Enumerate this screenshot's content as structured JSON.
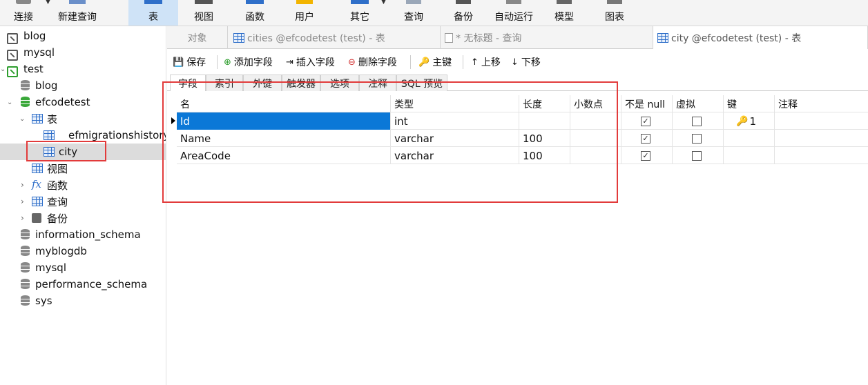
{
  "toolbar": {
    "items": [
      {
        "label": "连接",
        "icon": "connect-icon"
      },
      {
        "label": "新建查询",
        "icon": "new-query-icon"
      },
      {
        "label": "表",
        "icon": "table-icon"
      },
      {
        "label": "视图",
        "icon": "view-icon"
      },
      {
        "label": "函数",
        "icon": "function-icon"
      },
      {
        "label": "用户",
        "icon": "user-icon"
      },
      {
        "label": "其它",
        "icon": "other-icon"
      },
      {
        "label": "查询",
        "icon": "query-icon"
      },
      {
        "label": "备份",
        "icon": "backup-icon"
      },
      {
        "label": "自动运行",
        "icon": "schedule-icon"
      },
      {
        "label": "模型",
        "icon": "model-icon"
      },
      {
        "label": "图表",
        "icon": "chart-icon"
      }
    ]
  },
  "sidebar": {
    "conn_blog": "blog",
    "conn_mysql": "mysql",
    "conn_test": "test",
    "db_blog": "blog",
    "db_efcodetest": "efcodetest",
    "node_tables": "表",
    "table_efmigrations": "efmigrationshistory",
    "table_city": "city",
    "node_views": "视图",
    "node_functions": "函数",
    "node_queries": "查询",
    "node_backups": "备份",
    "db_information_schema": "information_schema",
    "db_myblogdb": "myblogdb",
    "db_mysql": "mysql",
    "db_performance_schema": "performance_schema",
    "db_sys": "sys"
  },
  "tabs": {
    "objects": "对象",
    "cities": "cities @efcodetest (test) - 表",
    "untitled": "* 无标题 - 查询",
    "city": "city @efcodetest (test) - 表"
  },
  "actions": {
    "save": "保存",
    "add_field": "添加字段",
    "insert_field": "插入字段",
    "delete_field": "删除字段",
    "primary_key": "主键",
    "move_up": "上移",
    "move_down": "下移"
  },
  "subtabs": [
    "字段",
    "索引",
    "外键",
    "触发器",
    "选项",
    "注释",
    "SQL 预览"
  ],
  "grid": {
    "headers": {
      "name": "名",
      "type": "类型",
      "length": "长度",
      "decimals": "小数点",
      "not_null": "不是 null",
      "virtual": "虚拟",
      "key": "键",
      "comment": "注释"
    },
    "rows": [
      {
        "name": "Id",
        "type": "int",
        "length": "",
        "decimals": "",
        "not_null": true,
        "virtual": false,
        "key": "1"
      },
      {
        "name": "Name",
        "type": "varchar",
        "length": "100",
        "decimals": "",
        "not_null": true,
        "virtual": false,
        "key": ""
      },
      {
        "name": "AreaCode",
        "type": "varchar",
        "length": "100",
        "decimals": "",
        "not_null": true,
        "virtual": false,
        "key": ""
      }
    ]
  },
  "colors": {
    "selection": "#0b78d7",
    "annotation_red": "#e23b3b",
    "active_toolbar": "#cfe3f7",
    "db_green": "#3aa83a"
  }
}
